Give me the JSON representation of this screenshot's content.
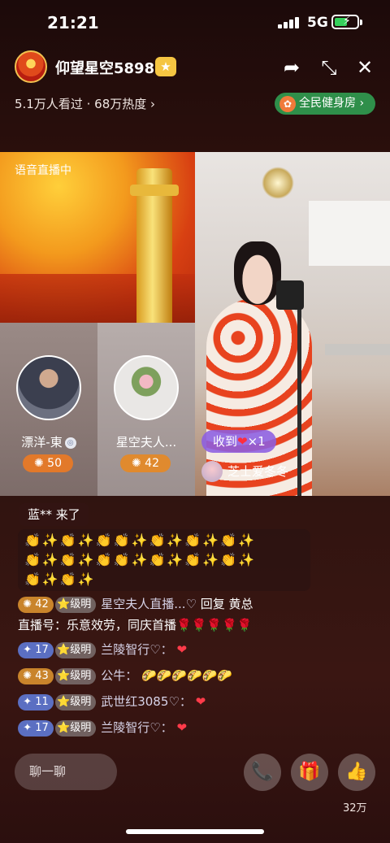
{
  "status_bar": {
    "time": "21:21",
    "network": "5G"
  },
  "header": {
    "host_name": "仰望星空5898",
    "stats": "5.1万人看过 · 68万热度 ›",
    "gym_label": "全民健身房 ›",
    "icons": [
      "share-icon",
      "collapse-icon",
      "close-icon"
    ]
  },
  "stage": {
    "voice_label": "语音直播中",
    "guests": [
      {
        "name": "漂洋-東",
        "score": "50"
      },
      {
        "name": "星空夫人...",
        "score": "42"
      }
    ],
    "gift_text": "收到",
    "gift_count": "×1",
    "gift_user": "芝士爱冬冬"
  },
  "chat": {
    "arrival": "蓝** 来了",
    "emoji_lines": [
      "👏✨👏✨👏👏✨👏✨👏✨👏✨",
      "👏✨👏✨👏👏✨👏✨👏✨👏✨",
      "👏✨👏✨"
    ],
    "messages": [
      {
        "level": "42",
        "rank": "级明",
        "user": "星空夫人直播...♡",
        "text": "回复 黄总",
        "line2": "直播号：乐意效劳，同庆首播🌹🌹🌹🌹🌹"
      },
      {
        "level": "17",
        "rank": "级明",
        "user": "兰陵智行♡：",
        "text": "❤"
      },
      {
        "level": "43",
        "rank": "级明",
        "user": "公牛：",
        "text": "🌮🌮🌮🌮🌮🌮"
      },
      {
        "level": "11",
        "rank": "级明",
        "user": "武世红3085♡：",
        "text": "❤"
      },
      {
        "level": "17",
        "rank": "级明",
        "user": "兰陵智行♡：",
        "text": "❤"
      }
    ]
  },
  "bottom": {
    "input_placeholder": "聊一聊",
    "like_count": "32万"
  },
  "colors": {
    "accent_green": "#2f8f4a",
    "level_orange": "#c9842b",
    "level_blue": "#5b6fc2"
  }
}
